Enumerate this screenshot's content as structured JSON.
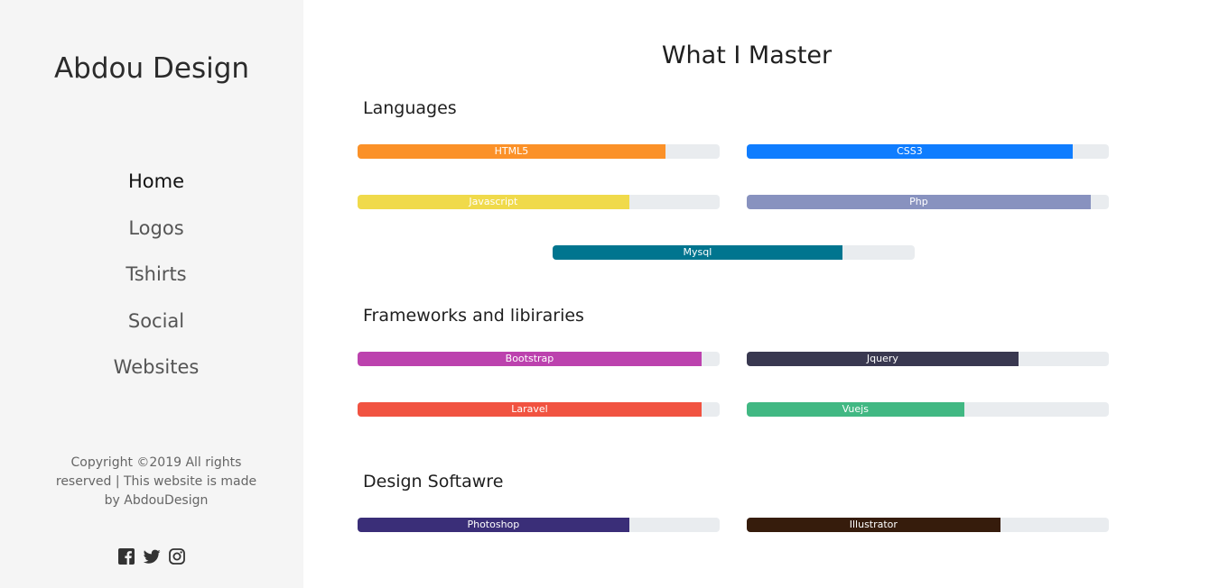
{
  "sidebar": {
    "brand": "Abdou Design",
    "nav": [
      "Home",
      "Logos",
      "Tshirts",
      "Social",
      "Websites"
    ],
    "copyright": "Copyright ©2019 All rights reserved | This website is made by AbdouDesign",
    "social_icons": [
      "facebook-icon",
      "twitter-icon",
      "instagram-icon"
    ]
  },
  "main": {
    "title": "What I Master",
    "sections": [
      {
        "title": "Languages",
        "skills": [
          {
            "label": "HTML5",
            "percent": 85,
            "color": "#fb9128"
          },
          {
            "label": "CSS3",
            "percent": 90,
            "color": "#0f7dff"
          },
          {
            "label": "Javascript",
            "percent": 75,
            "color": "#f0da4b"
          },
          {
            "label": "Php",
            "percent": 95,
            "color": "#8892bf"
          },
          {
            "label": "Mysql",
            "percent": 80,
            "color": "#00758f"
          }
        ]
      },
      {
        "title": "Frameworks and libiraries",
        "skills": [
          {
            "label": "Bootstrap",
            "percent": 95,
            "color": "#bc42ae"
          },
          {
            "label": "Jquery",
            "percent": 75,
            "color": "#393850"
          },
          {
            "label": "Laravel",
            "percent": 95,
            "color": "#f15341"
          },
          {
            "label": "Vuejs",
            "percent": 60,
            "color": "#41b883"
          }
        ]
      },
      {
        "title": "Design Softawre",
        "skills": [
          {
            "label": "Photoshop",
            "percent": 75,
            "color": "#3a2e78"
          },
          {
            "label": "Illustrator",
            "percent": 70,
            "color": "#361c0c"
          }
        ]
      }
    ]
  }
}
